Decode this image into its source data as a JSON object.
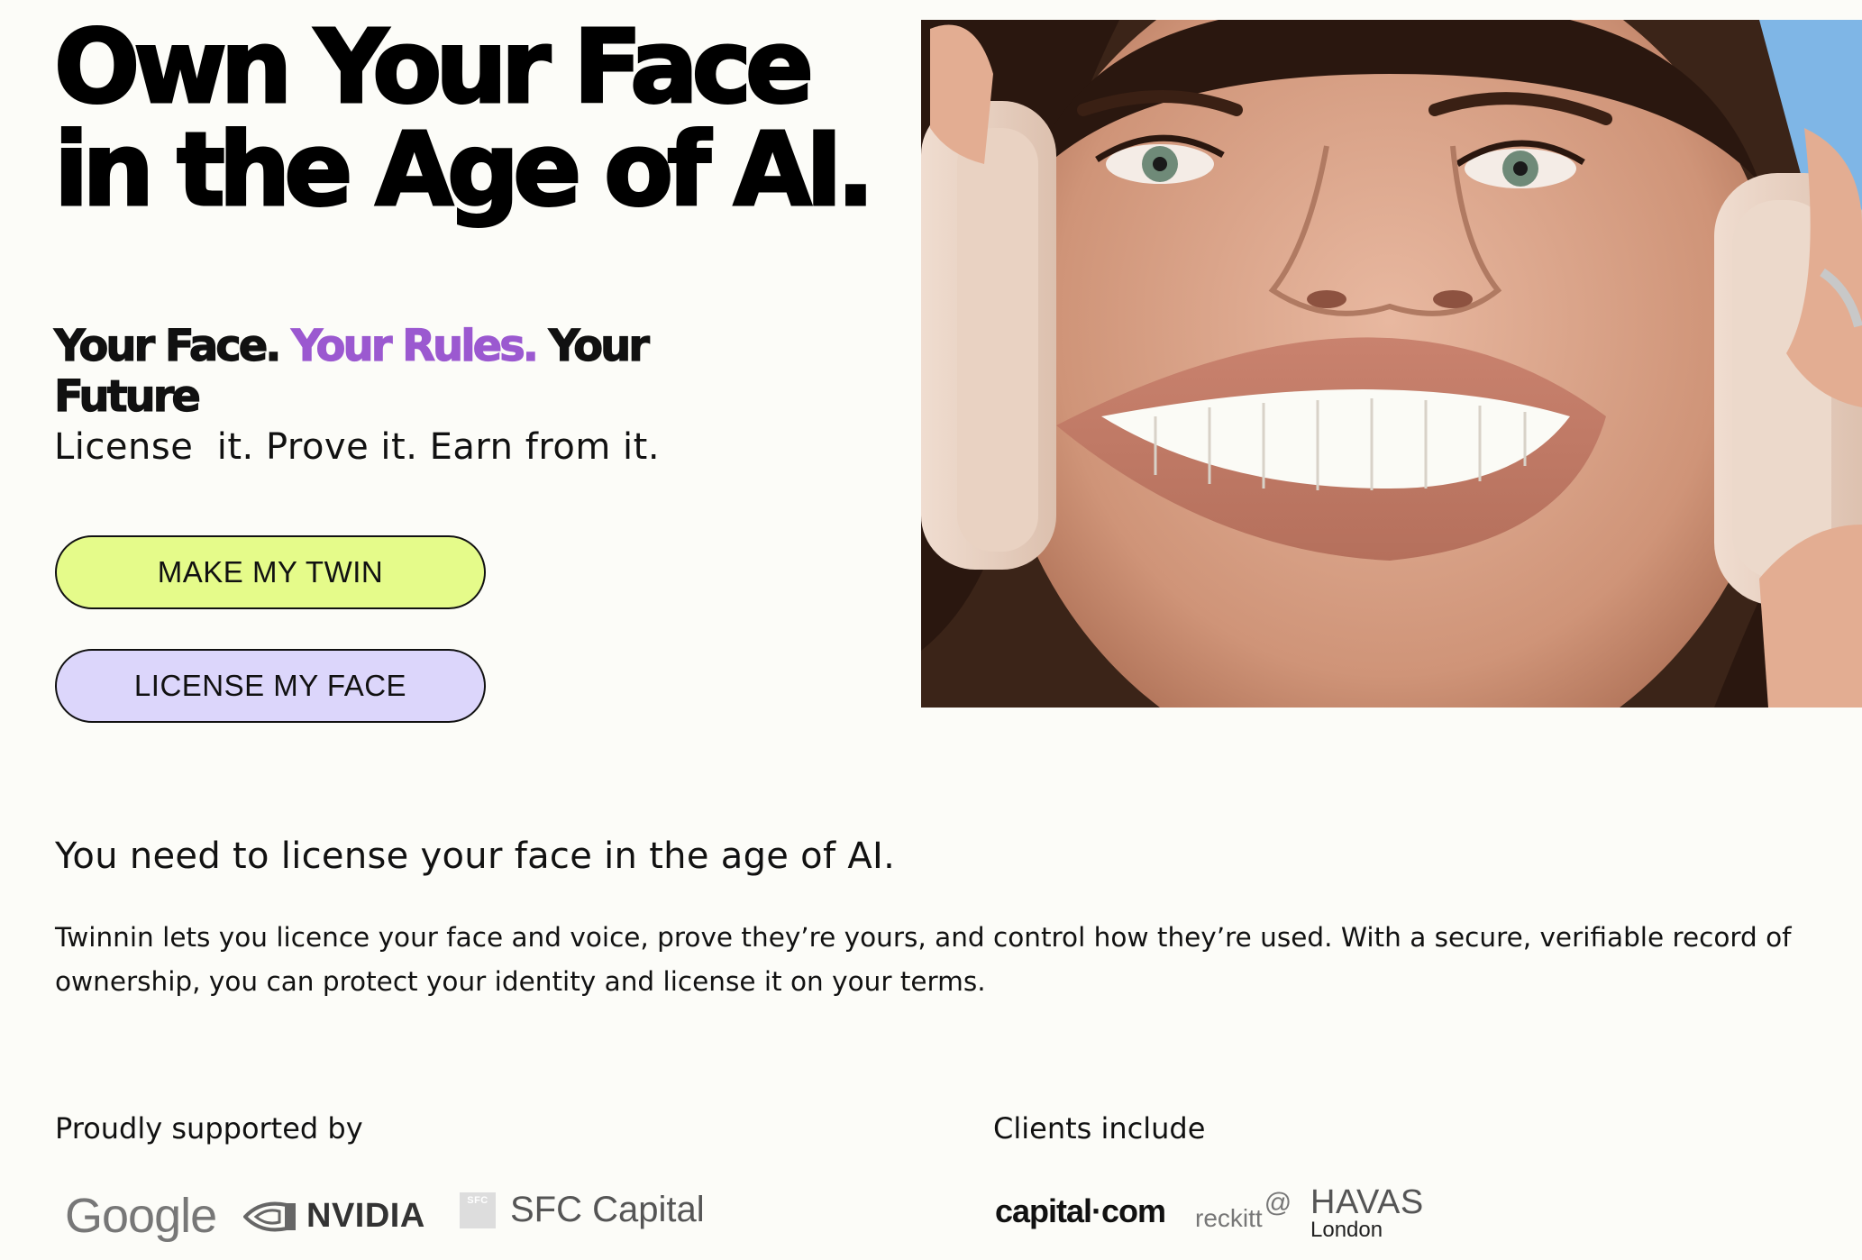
{
  "hero": {
    "title": "Own Your Face in the Age of AI.",
    "tagline_part1": "Your Face. ",
    "tagline_part2": "Your Rules.",
    "tagline_part3": " Your Future",
    "subtitle": "License  it. Prove it. Earn from it.",
    "cta_primary": "MAKE MY TWIN",
    "cta_secondary": "LICENSE MY FACE",
    "accent_color": "#9b59d0",
    "primary_button_color": "#e5fb8a",
    "secondary_button_color": "#dcd6fb"
  },
  "about": {
    "heading": "You need to license your face in the age of AI.",
    "body": "Twinnin lets you licence your face and voice, prove they’re yours, and control how they’re used. With a secure, verifiable record of ownership, you can protect your identity and license it on your terms."
  },
  "supporters": {
    "label": "Proudly supported by",
    "logos": {
      "google": "Google",
      "nvidia": "NVIDIA",
      "sfc_mark": "SFC",
      "sfc": "SFC Capital"
    }
  },
  "clients": {
    "label": "Clients include",
    "logos": {
      "capital": "capital·com",
      "reckitt": "reckitt",
      "havas": "HAVAS",
      "havas_city": "London"
    }
  }
}
